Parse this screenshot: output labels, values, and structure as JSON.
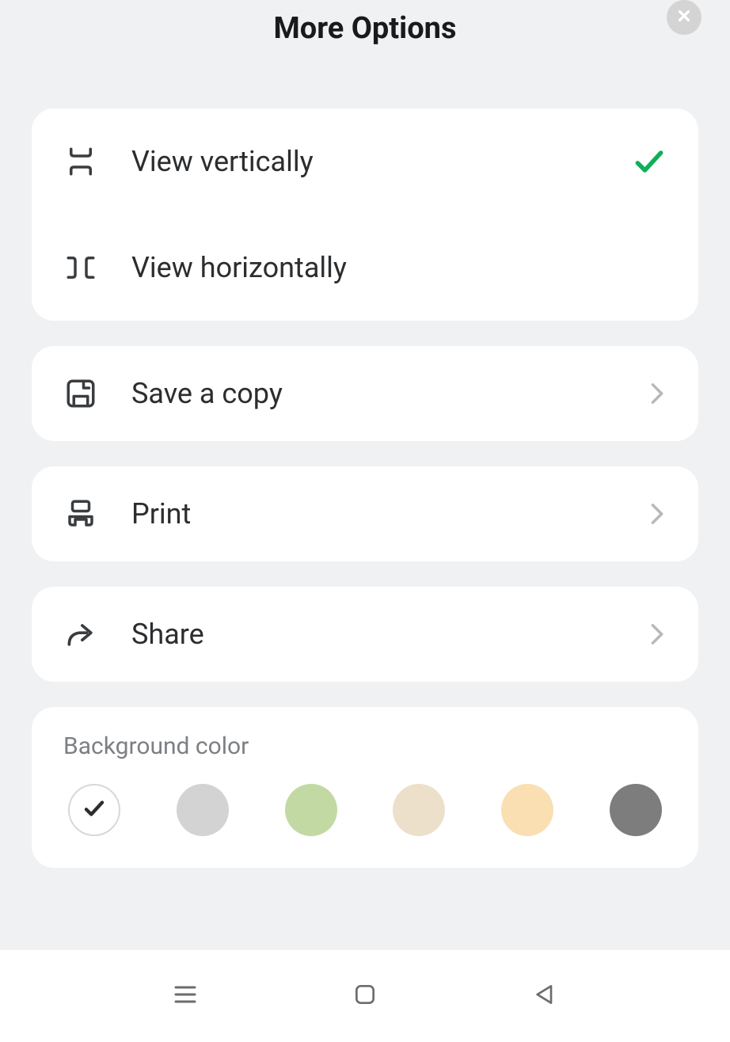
{
  "header": {
    "title": "More Options"
  },
  "view_options": {
    "vertical": {
      "label": "View vertically",
      "selected": true
    },
    "horizontal": {
      "label": "View horizontally",
      "selected": false
    }
  },
  "actions": {
    "save_copy": {
      "label": "Save a copy"
    },
    "print": {
      "label": "Print"
    },
    "share": {
      "label": "Share"
    }
  },
  "background": {
    "label": "Background color",
    "swatches": [
      {
        "color": "#ffffff",
        "selected": true
      },
      {
        "color": "#d3d3d3",
        "selected": false
      },
      {
        "color": "#c2d9a4",
        "selected": false
      },
      {
        "color": "#ede0ca",
        "selected": false
      },
      {
        "color": "#f9dfb2",
        "selected": false
      },
      {
        "color": "#7d7d7d",
        "selected": false
      }
    ]
  }
}
